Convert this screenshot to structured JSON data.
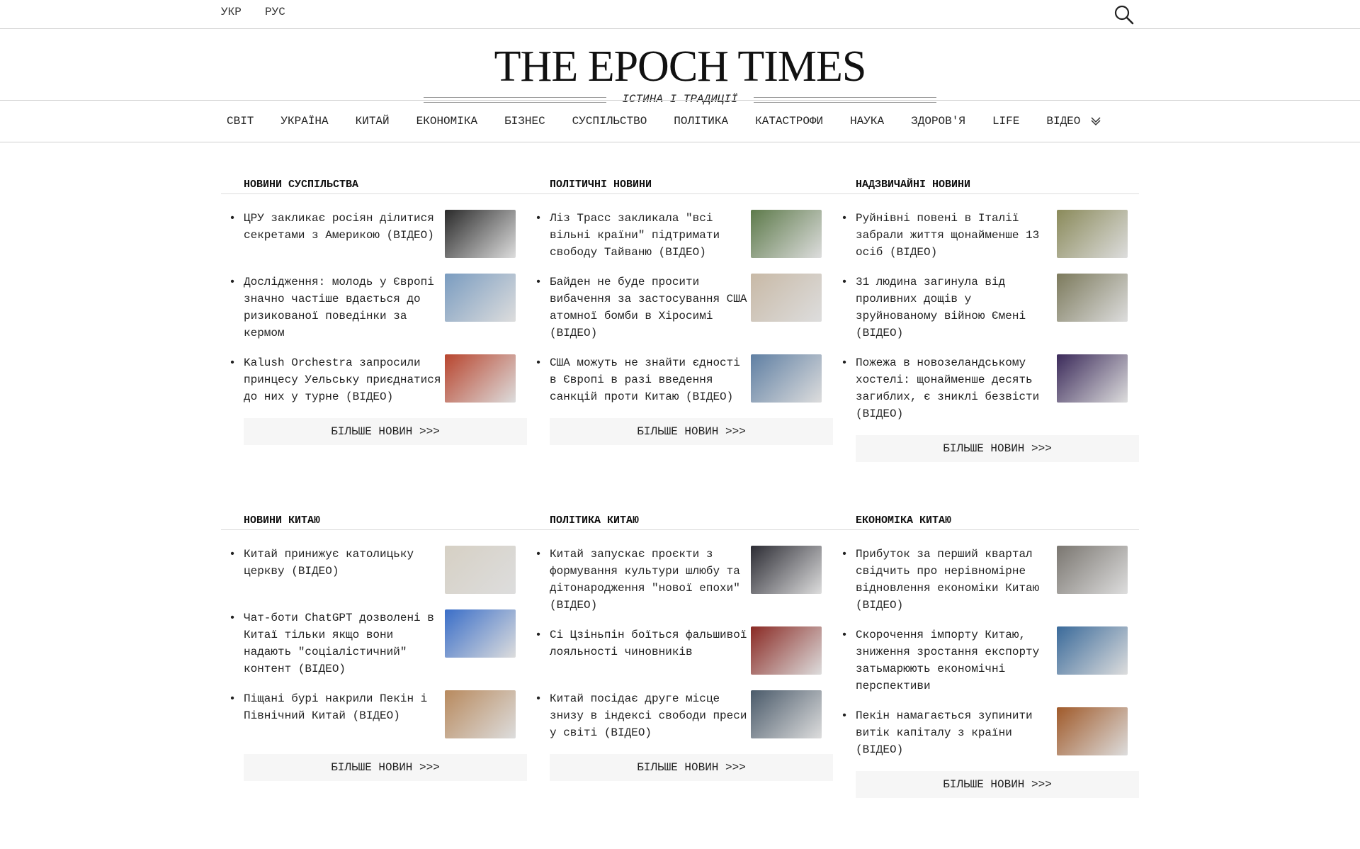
{
  "topbar": {
    "lang_ukr": "УКР",
    "lang_rus": "РУС",
    "search_icon": "search-icon"
  },
  "masthead": {
    "logo": "THE EPOCH TIMES",
    "tagline": "ІСТИНА І ТРАДИЦІЇ"
  },
  "nav": {
    "items": [
      "СВІТ",
      "УКРАЇНА",
      "КИТАЙ",
      "ЕКОНОМІКА",
      "БІЗНЕС",
      "СУСПІЛЬСТВО",
      "ПОЛІТИКА",
      "КАТАСТРОФИ",
      "НАУКА",
      "ЗДОРОВ'Я",
      "LIFE",
      "ВІДЕО"
    ],
    "more_icon": "chevron-double-down-icon"
  },
  "more_label": "БІЛЬШЕ НОВИН >>>",
  "sections": [
    {
      "title": "НОВИНИ СУСПІЛЬСТВА",
      "items": [
        {
          "text": "ЦРУ закликає росіян ділитися секретами з Америкою (ВІДЕО)",
          "thumb": "#2a2a2a"
        },
        {
          "text": "Дослідження: молодь у Європі значно частіше вдається до ризикованої поведінки за кермом",
          "thumb": "#7a9cc0"
        },
        {
          "text": "Kalush Orchestra запросили принцесу Уельську приєднатися до них у турне (ВІДЕО)",
          "thumb": "#b8452e"
        }
      ]
    },
    {
      "title": "ПОЛІТИЧНІ НОВИНИ",
      "items": [
        {
          "text": "Ліз Трасс закликала \"всі вільні країни\" підтримати свободу Тайваню (ВІДЕО)",
          "thumb": "#5d7a4a"
        },
        {
          "text": "Байден не буде просити вибачення за застосування США атомної бомби в Хіросимі (ВІДЕО)",
          "thumb": "#c8b9a6"
        },
        {
          "text": "США можуть не знайти єдності в Європі в разі введення санкцій проти Китаю (ВІДЕО)",
          "thumb": "#5f7fa3"
        }
      ]
    },
    {
      "title": "НАДЗВИЧАЙНІ НОВИНИ",
      "items": [
        {
          "text": "Руйнівні повені в Італії забрали життя щонайменше 13 осіб (ВІДЕО)",
          "thumb": "#8a8a5a"
        },
        {
          "text": "31 людина загинула від проливних дощів у зруйнованому війною Ємені (ВІДЕО)",
          "thumb": "#7c7a5c"
        },
        {
          "text": "Пожежа в новозеландському хостелі: щонайменше десять загиблих, є зниклі безвісти (ВІДЕО)",
          "thumb": "#3b2a5a"
        }
      ]
    },
    {
      "title": "НОВИНИ КИТАЮ",
      "items": [
        {
          "text": "Китай принижує католицьку церкву (ВІДЕО)",
          "thumb": "#d6d0c4"
        },
        {
          "text": "Чат-боти ChatGPT дозволені в Китаї тільки якщо вони надають \"соціалістичний\" контент (ВІДЕО)",
          "thumb": "#3a6ec8"
        },
        {
          "text": "Піщані бурі накрили Пекін і Північний Китай (ВІДЕО)",
          "thumb": "#b88a5e"
        }
      ]
    },
    {
      "title": "ПОЛІТИКА КИТАЮ",
      "items": [
        {
          "text": "Китай запускає проєкти з формування культури шлюбу та дітонародження \"нової епохи\" (ВІДЕО)",
          "thumb": "#2c2c34"
        },
        {
          "text": "Сі Цзіньпін боїться фальшивої лояльності чиновників",
          "thumb": "#8a2a24"
        },
        {
          "text": "Китай посідає друге місце знизу в індексі свободи преси у світі (ВІДЕО)",
          "thumb": "#4a5a6a"
        }
      ]
    },
    {
      "title": "ЕКОНОМІКА КИТАЮ",
      "items": [
        {
          "text": "Прибуток за перший квартал свідчить про нерівномірне відновлення економіки Китаю (ВІДЕО)",
          "thumb": "#7a7670"
        },
        {
          "text": "Скорочення імпорту Китаю, зниження зростання експорту затьмарюють економічні перспективи",
          "thumb": "#3a6a9a"
        },
        {
          "text": "Пекін намагається зупинити витік капіталу з країни (ВІДЕО)",
          "thumb": "#a05a2a"
        }
      ]
    }
  ]
}
